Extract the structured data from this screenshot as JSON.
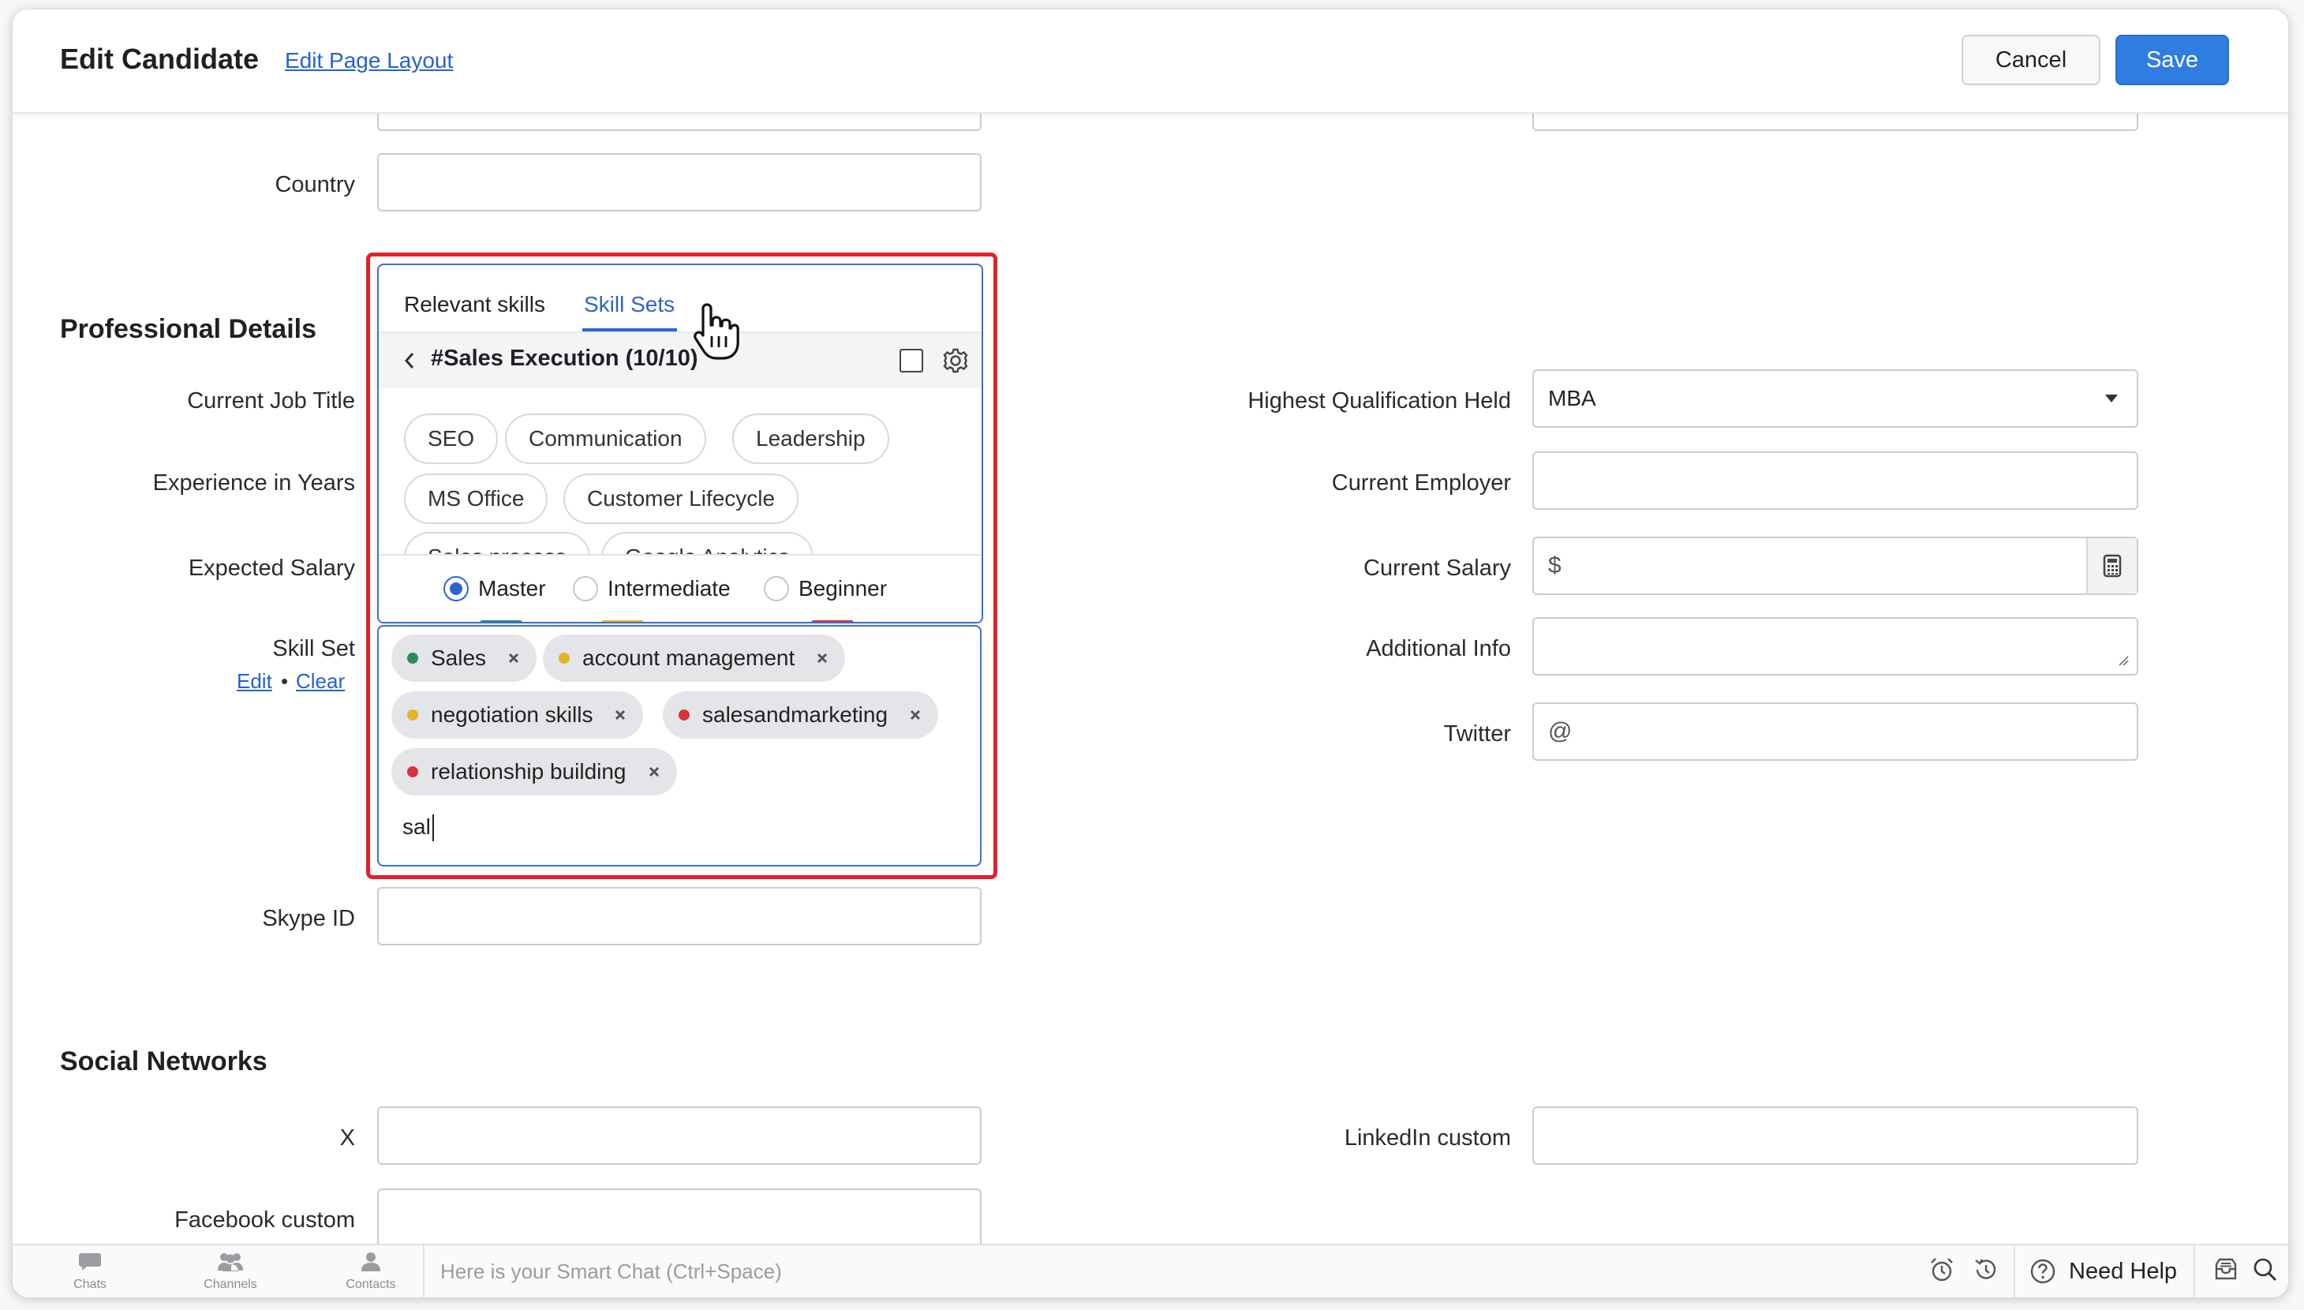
{
  "header": {
    "title": "Edit Candidate",
    "edit_layout_link": "Edit Page Layout",
    "cancel_label": "Cancel",
    "save_label": "Save"
  },
  "fields": {
    "country_label": "Country",
    "professional_section": "Professional Details",
    "current_job_title_label": "Current Job Title",
    "experience_label": "Experience in Years",
    "expected_salary_label": "Expected Salary",
    "skill_set_label": "Skill Set",
    "skill_set_edit": "Edit",
    "skill_set_bullet": "•",
    "skill_set_clear": "Clear",
    "skype_label": "Skype ID",
    "highest_qualification_label": "Highest Qualification Held",
    "highest_qualification_value": "MBA",
    "current_employer_label": "Current Employer",
    "current_salary_label": "Current Salary",
    "current_salary_prefix": "$",
    "additional_info_label": "Additional Info",
    "twitter_label": "Twitter",
    "twitter_prefix": "@"
  },
  "social": {
    "section": "Social Networks",
    "x_label": "X",
    "facebook_label": "Facebook custom",
    "linkedin_label": "LinkedIn custom"
  },
  "skill_popup": {
    "tabs": [
      "Relevant skills",
      "Skill Sets"
    ],
    "active_tab": "Skill Sets",
    "set_title": "#Sales Execution (10/10)",
    "chips": [
      "SEO",
      "Communication",
      "Leadership",
      "MS Office",
      "Customer Lifecycle",
      "Sales process",
      "Google Analytics"
    ],
    "levels": [
      {
        "label": "Master",
        "color": "#2e8b57",
        "selected": true
      },
      {
        "label": "Intermediate",
        "color": "#e6b422",
        "selected": false
      },
      {
        "label": "Beginner",
        "color": "#d8333a",
        "selected": false
      }
    ]
  },
  "selected_skills": [
    {
      "label": "Sales",
      "level_color": "#2e8b57"
    },
    {
      "label": "account management",
      "level_color": "#e6b422"
    },
    {
      "label": "negotiation skills",
      "level_color": "#e6b422"
    },
    {
      "label": "salesandmarketing",
      "level_color": "#d8333a"
    },
    {
      "label": "relationship building",
      "level_color": "#d8333a"
    }
  ],
  "skill_input_value": "sal",
  "bottom_bar": {
    "chats": "Chats",
    "channels": "Channels",
    "contacts": "Contacts",
    "smart_chat_placeholder": "Here is your Smart Chat (Ctrl+Space)",
    "need_help": "Need Help"
  },
  "colors": {
    "accent": "#2f7de1",
    "link": "#2563c9",
    "highlight_frame": "#e0212d"
  }
}
